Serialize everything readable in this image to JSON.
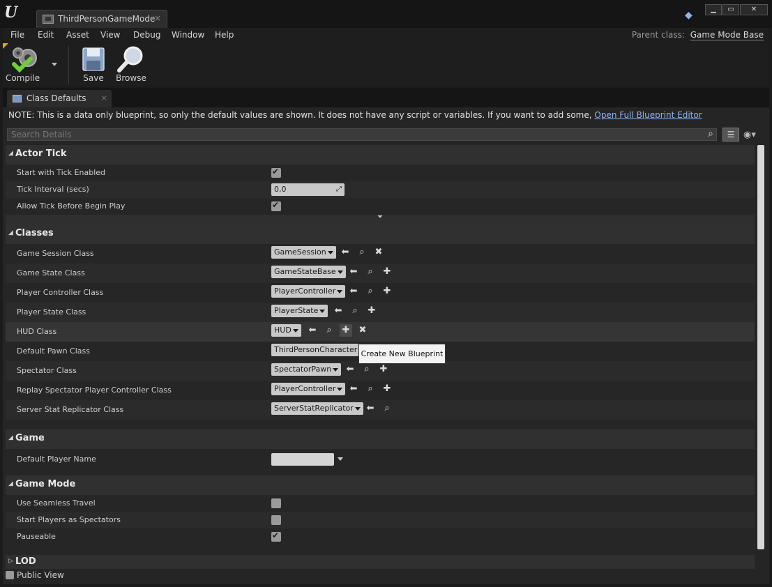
{
  "window": {
    "tab_title": "ThirdPersonGameMode",
    "tab_close": "×",
    "win_buttons": {
      "minimize": "▁",
      "maximize": "▭",
      "close": "✕"
    }
  },
  "menu": {
    "items": [
      "File",
      "Edit",
      "Asset",
      "View",
      "Debug",
      "Window",
      "Help"
    ],
    "parent_label": "Parent class:",
    "parent_value": "Game Mode Base"
  },
  "toolbar": {
    "compile": "Compile",
    "save": "Save",
    "browse": "Browse"
  },
  "panel_tab": {
    "label": "Class Defaults",
    "close": "×"
  },
  "note": {
    "text": "NOTE: This is a data only blueprint, so only the default values are shown.  It does not have any script or variables.  If you want to add some,",
    "link": "Open Full Blueprint Editor"
  },
  "search": {
    "placeholder": "Search Details"
  },
  "categories": {
    "actor_tick": {
      "label": "Actor Tick",
      "start_with_tick": {
        "label": "Start with Tick Enabled",
        "checked": true
      },
      "tick_interval": {
        "label": "Tick Interval (secs)",
        "value": "0,0"
      },
      "allow_tick": {
        "label": "Allow Tick Before Begin Play",
        "checked": true
      }
    },
    "classes": {
      "label": "Classes",
      "rows": [
        {
          "label": "Game Session Class",
          "value": "GameSession"
        },
        {
          "label": "Game State Class",
          "value": "GameStateBase"
        },
        {
          "label": "Player Controller Class",
          "value": "PlayerController"
        },
        {
          "label": "Player State Class",
          "value": "PlayerState"
        },
        {
          "label": "HUD Class",
          "value": "HUD"
        },
        {
          "label": "Default Pawn Class",
          "value": "ThirdPersonCharacter"
        },
        {
          "label": "Spectator Class",
          "value": "SpectatorPawn"
        },
        {
          "label": "Replay Spectator Player Controller Class",
          "value": "PlayerController"
        },
        {
          "label": "Server Stat Replicator Class",
          "value": "ServerStatReplicator"
        }
      ]
    },
    "game": {
      "label": "Game",
      "default_player_name": {
        "label": "Default Player Name",
        "value": ""
      }
    },
    "game_mode": {
      "label": "Game Mode",
      "seamless_travel": {
        "label": "Use Seamless Travel",
        "checked": false
      },
      "start_spectators": {
        "label": "Start Players as Spectators",
        "checked": false
      },
      "pauseable": {
        "label": "Pauseable",
        "checked": true
      }
    },
    "lod": {
      "label": "LOD"
    }
  },
  "tooltip": {
    "text": "Create New Blueprint"
  },
  "footer": {
    "public_view": "Public View"
  }
}
